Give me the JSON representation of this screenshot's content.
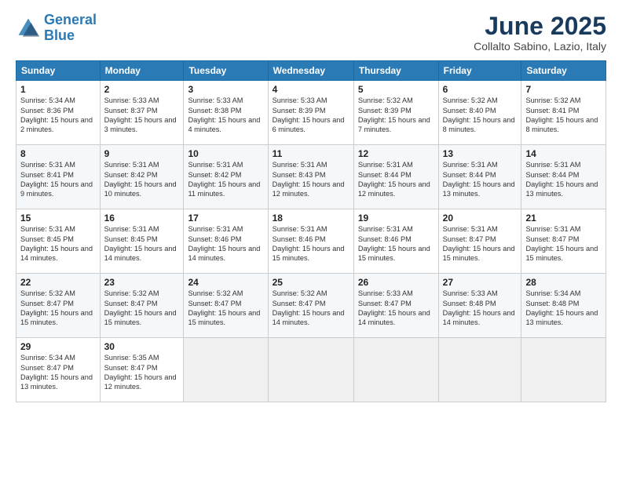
{
  "header": {
    "logo_line1": "General",
    "logo_line2": "Blue",
    "month_title": "June 2025",
    "location": "Collalto Sabino, Lazio, Italy"
  },
  "days_of_week": [
    "Sunday",
    "Monday",
    "Tuesday",
    "Wednesday",
    "Thursday",
    "Friday",
    "Saturday"
  ],
  "weeks": [
    [
      {
        "day": "1",
        "sunrise": "5:34 AM",
        "sunset": "8:36 PM",
        "daylight": "15 hours and 2 minutes."
      },
      {
        "day": "2",
        "sunrise": "5:33 AM",
        "sunset": "8:37 PM",
        "daylight": "15 hours and 3 minutes."
      },
      {
        "day": "3",
        "sunrise": "5:33 AM",
        "sunset": "8:38 PM",
        "daylight": "15 hours and 4 minutes."
      },
      {
        "day": "4",
        "sunrise": "5:33 AM",
        "sunset": "8:39 PM",
        "daylight": "15 hours and 6 minutes."
      },
      {
        "day": "5",
        "sunrise": "5:32 AM",
        "sunset": "8:39 PM",
        "daylight": "15 hours and 7 minutes."
      },
      {
        "day": "6",
        "sunrise": "5:32 AM",
        "sunset": "8:40 PM",
        "daylight": "15 hours and 8 minutes."
      },
      {
        "day": "7",
        "sunrise": "5:32 AM",
        "sunset": "8:41 PM",
        "daylight": "15 hours and 8 minutes."
      }
    ],
    [
      {
        "day": "8",
        "sunrise": "5:31 AM",
        "sunset": "8:41 PM",
        "daylight": "15 hours and 9 minutes."
      },
      {
        "day": "9",
        "sunrise": "5:31 AM",
        "sunset": "8:42 PM",
        "daylight": "15 hours and 10 minutes."
      },
      {
        "day": "10",
        "sunrise": "5:31 AM",
        "sunset": "8:42 PM",
        "daylight": "15 hours and 11 minutes."
      },
      {
        "day": "11",
        "sunrise": "5:31 AM",
        "sunset": "8:43 PM",
        "daylight": "15 hours and 12 minutes."
      },
      {
        "day": "12",
        "sunrise": "5:31 AM",
        "sunset": "8:44 PM",
        "daylight": "15 hours and 12 minutes."
      },
      {
        "day": "13",
        "sunrise": "5:31 AM",
        "sunset": "8:44 PM",
        "daylight": "15 hours and 13 minutes."
      },
      {
        "day": "14",
        "sunrise": "5:31 AM",
        "sunset": "8:44 PM",
        "daylight": "15 hours and 13 minutes."
      }
    ],
    [
      {
        "day": "15",
        "sunrise": "5:31 AM",
        "sunset": "8:45 PM",
        "daylight": "15 hours and 14 minutes."
      },
      {
        "day": "16",
        "sunrise": "5:31 AM",
        "sunset": "8:45 PM",
        "daylight": "15 hours and 14 minutes."
      },
      {
        "day": "17",
        "sunrise": "5:31 AM",
        "sunset": "8:46 PM",
        "daylight": "15 hours and 14 minutes."
      },
      {
        "day": "18",
        "sunrise": "5:31 AM",
        "sunset": "8:46 PM",
        "daylight": "15 hours and 15 minutes."
      },
      {
        "day": "19",
        "sunrise": "5:31 AM",
        "sunset": "8:46 PM",
        "daylight": "15 hours and 15 minutes."
      },
      {
        "day": "20",
        "sunrise": "5:31 AM",
        "sunset": "8:47 PM",
        "daylight": "15 hours and 15 minutes."
      },
      {
        "day": "21",
        "sunrise": "5:31 AM",
        "sunset": "8:47 PM",
        "daylight": "15 hours and 15 minutes."
      }
    ],
    [
      {
        "day": "22",
        "sunrise": "5:32 AM",
        "sunset": "8:47 PM",
        "daylight": "15 hours and 15 minutes."
      },
      {
        "day": "23",
        "sunrise": "5:32 AM",
        "sunset": "8:47 PM",
        "daylight": "15 hours and 15 minutes."
      },
      {
        "day": "24",
        "sunrise": "5:32 AM",
        "sunset": "8:47 PM",
        "daylight": "15 hours and 15 minutes."
      },
      {
        "day": "25",
        "sunrise": "5:32 AM",
        "sunset": "8:47 PM",
        "daylight": "15 hours and 14 minutes."
      },
      {
        "day": "26",
        "sunrise": "5:33 AM",
        "sunset": "8:47 PM",
        "daylight": "15 hours and 14 minutes."
      },
      {
        "day": "27",
        "sunrise": "5:33 AM",
        "sunset": "8:48 PM",
        "daylight": "15 hours and 14 minutes."
      },
      {
        "day": "28",
        "sunrise": "5:34 AM",
        "sunset": "8:48 PM",
        "daylight": "15 hours and 13 minutes."
      }
    ],
    [
      {
        "day": "29",
        "sunrise": "5:34 AM",
        "sunset": "8:47 PM",
        "daylight": "15 hours and 13 minutes."
      },
      {
        "day": "30",
        "sunrise": "5:35 AM",
        "sunset": "8:47 PM",
        "daylight": "15 hours and 12 minutes."
      },
      null,
      null,
      null,
      null,
      null
    ]
  ]
}
